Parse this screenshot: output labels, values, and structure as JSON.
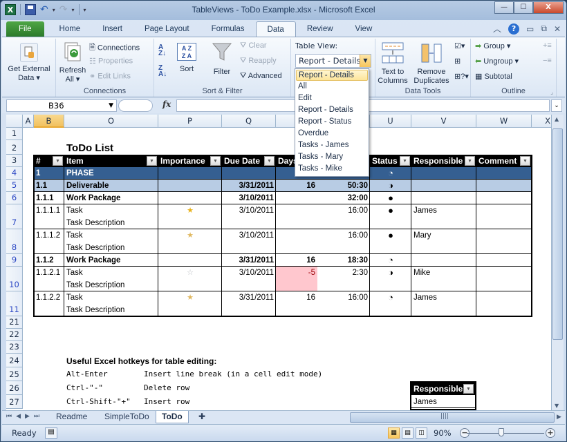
{
  "window": {
    "title": "TableViews - ToDo Example.xlsx  -  Microsoft Excel",
    "controls": {
      "minimize": "—",
      "maximize": "☐",
      "close": "X"
    }
  },
  "qat": {
    "logo": "X",
    "undo": "↶",
    "redo": "↷",
    "customize": "▾"
  },
  "ribbon_tabs": [
    "File",
    "Home",
    "Insert",
    "Page Layout",
    "Formulas",
    "Data",
    "Review",
    "View"
  ],
  "active_tab": "Data",
  "ribbon": {
    "get_external": {
      "label1": "Get External",
      "label2": "Data ▾"
    },
    "connections_group": {
      "label": "Connections",
      "refresh1": "Refresh",
      "refresh2": "All ▾",
      "connections": "Connections",
      "properties": "Properties",
      "edit_links": "Edit Links"
    },
    "sort_filter_group": {
      "label": "Sort & Filter",
      "sort": "Sort",
      "filter": "Filter",
      "clear": "Clear",
      "reapply": "Reapply",
      "advanced": "Advanced"
    },
    "table_view": {
      "label": "Table View:",
      "selected": "Report - Details",
      "options": [
        "Report - Details",
        "All",
        "Edit",
        "Report - Details",
        "Report - Status",
        "Overdue",
        "Tasks - James",
        "Tasks - Mary",
        "Tasks - Mike"
      ]
    },
    "data_tools_group": {
      "label": "Data Tools",
      "text_to_columns1": "Text to",
      "text_to_columns2": "Columns",
      "remove_dup1": "Remove",
      "remove_dup2": "Duplicates"
    },
    "outline_group": {
      "label": "Outline",
      "group": "Group ▾",
      "ungroup": "Ungroup ▾",
      "subtotal": "Subtotal"
    }
  },
  "formula_bar": {
    "name_box": "B36",
    "fx": "fx",
    "formula": ""
  },
  "columns": [
    "A",
    "B",
    "O",
    "P",
    "Q",
    "",
    "U",
    "V",
    "W",
    "X"
  ],
  "selected_column": "B",
  "rows": [
    "1",
    "2",
    "3",
    "4",
    "5",
    "6",
    "7",
    "8",
    "9",
    "10",
    "11",
    "21",
    "22",
    "23",
    "24",
    "25",
    "26",
    "27"
  ],
  "sheet": {
    "title": "ToDo List",
    "table_headers": [
      "#",
      "Item",
      "Importance",
      "Due Date",
      "Days",
      "",
      "Status",
      "Responsible",
      "Comment"
    ],
    "table_rows": [
      {
        "num": "1",
        "item": "PHASE",
        "desc": "",
        "importance": "",
        "due": "",
        "days": "",
        "time": "50:30",
        "status": "◔",
        "responsible": "",
        "comment": "",
        "style": "phase"
      },
      {
        "num": "1.1",
        "item": "Deliverable",
        "desc": "",
        "importance": "",
        "due": "3/31/2011",
        "days": "16",
        "time": "50:30",
        "status": "◑",
        "responsible": "",
        "comment": "",
        "style": "deliverable"
      },
      {
        "num": "1.1.1",
        "item": "Work Package",
        "desc": "",
        "importance": "",
        "due": "3/10/2011",
        "days": "",
        "time": "32:00",
        "status": "●",
        "responsible": "",
        "comment": "",
        "style": "wp"
      },
      {
        "num": "1.1.1.1",
        "item": "Task",
        "desc": "Task Description",
        "importance": "★",
        "due": "3/10/2011",
        "days": "",
        "time": "16:00",
        "status": "●",
        "responsible": "James",
        "comment": "",
        "style": "task",
        "star": "full"
      },
      {
        "num": "1.1.1.2",
        "item": "Task",
        "desc": "Task Description",
        "importance": "★",
        "due": "3/10/2011",
        "days": "",
        "time": "16:00",
        "status": "●",
        "responsible": "Mary",
        "comment": "",
        "style": "task",
        "star": "half"
      },
      {
        "num": "1.1.2",
        "item": "Work Package",
        "desc": "",
        "importance": "",
        "due": "3/31/2011",
        "days": "16",
        "time": "18:30",
        "status": "◔",
        "responsible": "",
        "comment": "",
        "style": "wp"
      },
      {
        "num": "1.1.2.1",
        "item": "Task",
        "desc": "Task Description",
        "importance": "☆",
        "due": "3/10/2011",
        "days": "-5",
        "time": "2:30",
        "status": "◑",
        "responsible": "Mike",
        "comment": "",
        "style": "task",
        "star": "empty",
        "overdue": true
      },
      {
        "num": "1.1.2.2",
        "item": "Task",
        "desc": "Task Description",
        "importance": "★",
        "due": "3/31/2011",
        "days": "16",
        "time": "16:00",
        "status": "◔",
        "responsible": "James",
        "comment": "",
        "style": "task",
        "star": "half"
      }
    ],
    "hotkeys_title": "Useful Excel hotkeys for table editing:",
    "hotkeys": [
      {
        "key": "Alt-Enter",
        "desc": "Insert line break (in a cell edit mode)"
      },
      {
        "key": "Ctrl-\"-\"",
        "desc": "Delete row"
      },
      {
        "key": "Ctrl-Shift-\"+\"",
        "desc": "Insert row"
      }
    ],
    "mini_table": {
      "header": "Responsible",
      "rows": [
        "James"
      ]
    }
  },
  "sheet_tabs": [
    "Readme",
    "SimpleToDo",
    "ToDo"
  ],
  "active_sheet": "ToDo",
  "status_bar": {
    "ready": "Ready",
    "zoom": "90%",
    "zoom_percent": 90
  },
  "colors": {
    "phase_bg": "#355f91",
    "deliverable_bg": "#b8cce4",
    "overdue_bg": "#ffc7ce",
    "overdue_text": "#9c0006",
    "header_bg": "#000000"
  }
}
